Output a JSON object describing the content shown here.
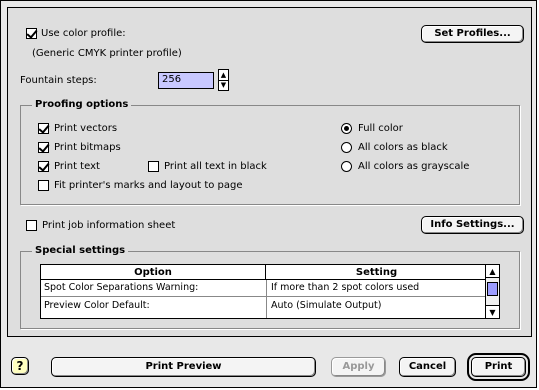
{
  "color_profile": {
    "checkbox_label": "Use color profile:",
    "profile_name": "(Generic CMYK printer profile)",
    "set_profiles_button": "Set Profiles..."
  },
  "fountain": {
    "label": "Fountain steps:",
    "value": "256"
  },
  "proofing": {
    "title": "Proofing options",
    "print_vectors": "Print vectors",
    "print_bitmaps": "Print bitmaps",
    "print_text": "Print text",
    "print_all_black": "Print all text in black",
    "fit_marks": "Fit printer's marks and layout to page",
    "full_color": "Full color",
    "all_black": "All colors as black",
    "all_gray": "All colors as grayscale"
  },
  "job_info": {
    "label": "Print job information sheet",
    "button": "Info Settings..."
  },
  "special": {
    "title": "Special settings",
    "headers": {
      "option": "Option",
      "setting": "Setting"
    },
    "rows": [
      {
        "option": "Spot Color Separations Warning:",
        "setting": "If more than 2 spot colors used"
      },
      {
        "option": "Preview Color Default:",
        "setting": "Auto (Simulate Output)"
      }
    ]
  },
  "footer": {
    "help": "?",
    "preview": "Print Preview",
    "apply": "Apply",
    "cancel": "Cancel",
    "print": "Print"
  }
}
